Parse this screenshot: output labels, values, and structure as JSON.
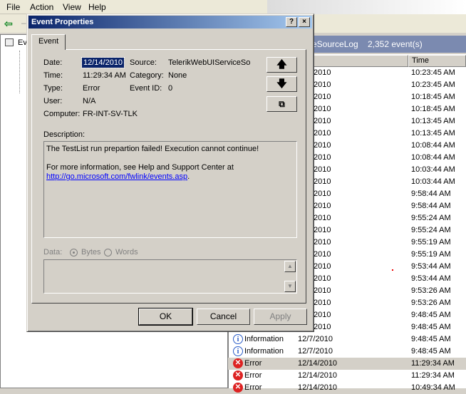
{
  "menu": [
    "File",
    "Action",
    "View",
    "Help"
  ],
  "menu_underline": [
    "F",
    "A",
    "V",
    "H"
  ],
  "list": {
    "title": "eSourceLog",
    "count": "2,352 event(s)",
    "col_time": "Time",
    "rows": [
      {
        "type": "",
        "date": "/2010",
        "time": "10:23:45 AM"
      },
      {
        "type": "",
        "date": "/2010",
        "time": "10:23:45 AM"
      },
      {
        "type": "",
        "date": "/2010",
        "time": "10:18:45 AM"
      },
      {
        "type": "",
        "date": "/2010",
        "time": "10:18:45 AM"
      },
      {
        "type": "",
        "date": "/2010",
        "time": "10:13:45 AM"
      },
      {
        "type": "",
        "date": "/2010",
        "time": "10:13:45 AM"
      },
      {
        "type": "",
        "date": "/2010",
        "time": "10:08:44 AM"
      },
      {
        "type": "",
        "date": "/2010",
        "time": "10:08:44 AM"
      },
      {
        "type": "",
        "date": "/2010",
        "time": "10:03:44 AM"
      },
      {
        "type": "",
        "date": "/2010",
        "time": "10:03:44 AM"
      },
      {
        "type": "",
        "date": "/2010",
        "time": "9:58:44 AM"
      },
      {
        "type": "",
        "date": "/2010",
        "time": "9:58:44 AM"
      },
      {
        "type": "",
        "date": "/2010",
        "time": "9:55:24 AM"
      },
      {
        "type": "",
        "date": "/2010",
        "time": "9:55:24 AM"
      },
      {
        "type": "",
        "date": "/2010",
        "time": "9:55:19 AM"
      },
      {
        "type": "",
        "date": "/2010",
        "time": "9:55:19 AM"
      },
      {
        "type": "",
        "date": "/2010",
        "time": "9:53:44 AM"
      },
      {
        "type": "",
        "date": "/2010",
        "time": "9:53:44 AM"
      },
      {
        "type": "",
        "date": "/2010",
        "time": "9:53:26 AM"
      },
      {
        "type": "",
        "date": "/2010",
        "time": "9:53:26 AM"
      },
      {
        "type": "",
        "date": "/2010",
        "time": "9:48:45 AM"
      },
      {
        "type": "",
        "date": "/2010",
        "time": "9:48:45 AM"
      },
      {
        "type": "Information",
        "date": "12/7/2010",
        "time": "9:48:45 AM"
      },
      {
        "type": "Information",
        "date": "12/7/2010",
        "time": "9:48:45 AM"
      },
      {
        "type": "Error",
        "date": "12/14/2010",
        "time": "11:29:34 AM"
      },
      {
        "type": "Error",
        "date": "12/14/2010",
        "time": "11:29:34 AM"
      },
      {
        "type": "Error",
        "date": "12/14/2010",
        "time": "10:49:34 AM"
      }
    ]
  },
  "dialog": {
    "title": "Event Properties",
    "help_btn": "?",
    "close_btn": "×",
    "tab": "Event",
    "labels": {
      "date": "Date:",
      "time": "Time:",
      "type": "Type:",
      "user": "User:",
      "computer": "Computer:",
      "source": "Source:",
      "category": "Category:",
      "event_id": "Event ID:",
      "description": "Description:",
      "data": "Data:",
      "bytes": "Bytes",
      "words": "Words"
    },
    "values": {
      "date": "12/14/2010",
      "time": "11:29:34 AM",
      "type": "Error",
      "user": "N/A",
      "computer": "FR-INT-SV-TLK",
      "source": "TelerikWebUIServiceSo",
      "category": "None",
      "event_id": "0"
    },
    "description_line1": "The TestList run prepartion failed! Execution cannot continue!",
    "description_line2": "For more information, see Help and Support Center at",
    "description_link": "http://go.microsoft.com/fwlink/events.asp",
    "description_end": ".",
    "buttons": {
      "ok": "OK",
      "cancel": "Cancel",
      "apply": "Apply"
    }
  },
  "icons": {
    "up": "arrow-up-icon",
    "down": "arrow-down-icon",
    "copy": "copy-icon",
    "error": "error-icon",
    "info": "information-icon"
  }
}
